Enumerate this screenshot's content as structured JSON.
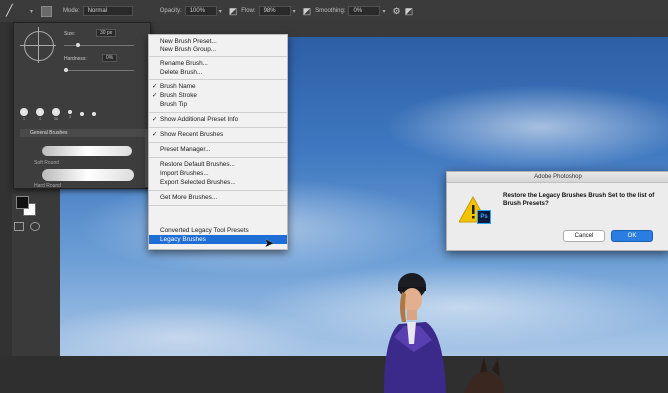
{
  "toolbar": {
    "mode_label": "Mode:",
    "mode_value": "Normal",
    "opacity_label": "Opacity:",
    "opacity_value": "100%",
    "flow_label": "Flow:",
    "flow_value": "98%",
    "smoothing_label": "Smoothing:",
    "smoothing_value": "0%"
  },
  "brush_picker": {
    "size_label": "Size:",
    "size_value": "30 px",
    "hardness_label": "Hardness:",
    "hardness_value": "0%",
    "tip_sizes": [
      "1",
      "4",
      "36",
      "3"
    ],
    "folder_name": "General Brushes",
    "brushes": [
      "Soft Round",
      "Hard Round"
    ]
  },
  "menu": {
    "items": [
      {
        "label": "New Brush Preset...",
        "checked": false
      },
      {
        "label": "New Brush Group...",
        "checked": false
      },
      {
        "label": "Rename Brush...",
        "checked": false
      },
      {
        "label": "Delete Brush...",
        "checked": false
      },
      {
        "label": "Brush Name",
        "checked": true
      },
      {
        "label": "Brush Stroke",
        "checked": true
      },
      {
        "label": "Brush Tip",
        "checked": false
      },
      {
        "label": "Show Additional Preset Info",
        "checked": true
      },
      {
        "label": "Show Recent Brushes",
        "checked": true
      },
      {
        "label": "Preset Manager...",
        "checked": false
      },
      {
        "label": "Restore Default Brushes...",
        "checked": false
      },
      {
        "label": "Import Brushes...",
        "checked": false
      },
      {
        "label": "Export Selected Brushes...",
        "checked": false
      },
      {
        "label": "Get More Brushes...",
        "checked": false
      },
      {
        "label": "Converted Legacy Tool Presets",
        "checked": false
      },
      {
        "label": "Legacy Brushes",
        "checked": false,
        "highlighted": true
      }
    ],
    "check_glyph": "✓"
  },
  "dialog": {
    "title": "Adobe Photoshop",
    "message": "Restore the Legacy Brushes Brush Set to the list of Brush Presets?",
    "cancel_label": "Cancel",
    "ok_label": "OK",
    "app_badge": "Ps"
  },
  "colors": {
    "menu_highlight": "#1f6ed6",
    "ok_button": "#2a7de1",
    "warning": "#f2c300"
  },
  "icons": [
    "brush-tool-icon",
    "airbrush-icon",
    "pressure-size-icon",
    "settings-gear-icon",
    "symmetry-icon",
    "warning-icon",
    "arrow-cursor-icon"
  ]
}
